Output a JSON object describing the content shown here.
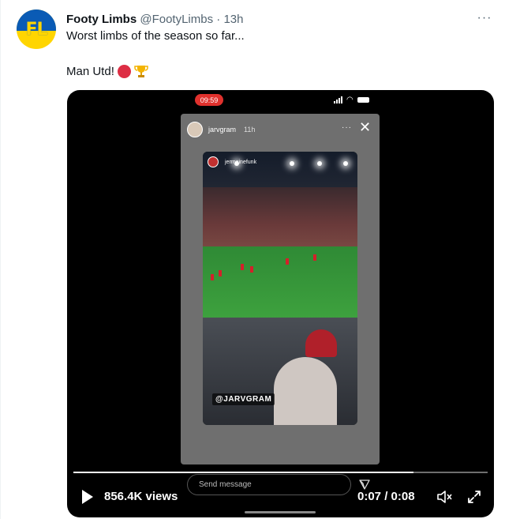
{
  "tweet": {
    "author_name": "Footy Limbs",
    "author_handle": "@FootyLimbs",
    "separator": "·",
    "time": "13h",
    "text_line1": "Worst limbs of the season so far...",
    "text_line2": "Man Utd!",
    "emojis": [
      "red-circle",
      "trophy"
    ],
    "avatar_text": "FL"
  },
  "video": {
    "phone_status_time": "09:59",
    "story": {
      "username": "jarvgram",
      "age": "11h",
      "inner_username": "jermainefunk",
      "watermark": "@JARVGRAM",
      "send_placeholder": "Send message"
    },
    "views": "856.4K views",
    "timecode": "0:07 / 0:08",
    "progress": 0.82
  },
  "colors": {
    "text": "#0f1419",
    "muted": "#536471",
    "media_bg": "#000000",
    "record_red": "#e0312d"
  }
}
